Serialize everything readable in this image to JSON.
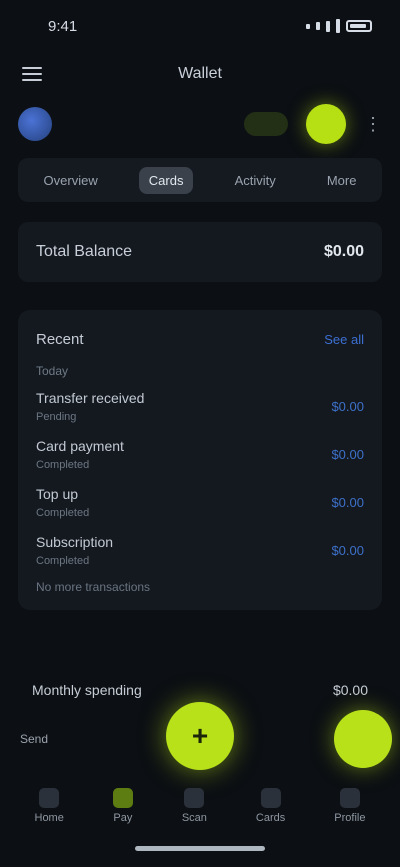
{
  "status_bar": {
    "time": "9:41",
    "battery": "100%"
  },
  "app_header": {
    "title": "Wallet"
  },
  "toolbar": {
    "more_label": "⋮"
  },
  "tabs": [
    {
      "label": "Overview"
    },
    {
      "label": "Cards"
    },
    {
      "label": "Activity"
    },
    {
      "label": "More"
    }
  ],
  "balance": {
    "label": "Total Balance",
    "value": "$0.00"
  },
  "transactions": {
    "title": "Recent",
    "link": "See all",
    "subtitle": "Today",
    "items": [
      {
        "name": "Transfer received",
        "sub": "Pending",
        "amount": "$0.00"
      },
      {
        "name": "Card payment",
        "sub": "Completed",
        "amount": "$0.00"
      },
      {
        "name": "Top up",
        "sub": "Completed",
        "amount": "$0.00"
      },
      {
        "name": "Subscription",
        "sub": "Completed",
        "amount": "$0.00"
      }
    ],
    "footer": "No more transactions"
  },
  "summary": {
    "label": "Monthly spending",
    "value": "$0.00"
  },
  "fab": {
    "main_symbol": "+"
  },
  "mini_label": "Send",
  "bottom_nav": [
    {
      "label": "Home"
    },
    {
      "label": "Pay"
    },
    {
      "label": "Scan"
    },
    {
      "label": "Cards"
    },
    {
      "label": "Profile"
    }
  ],
  "colors": {
    "background": "#0c0f13",
    "accent": "#b8e11a",
    "link": "#3b6fd1"
  }
}
